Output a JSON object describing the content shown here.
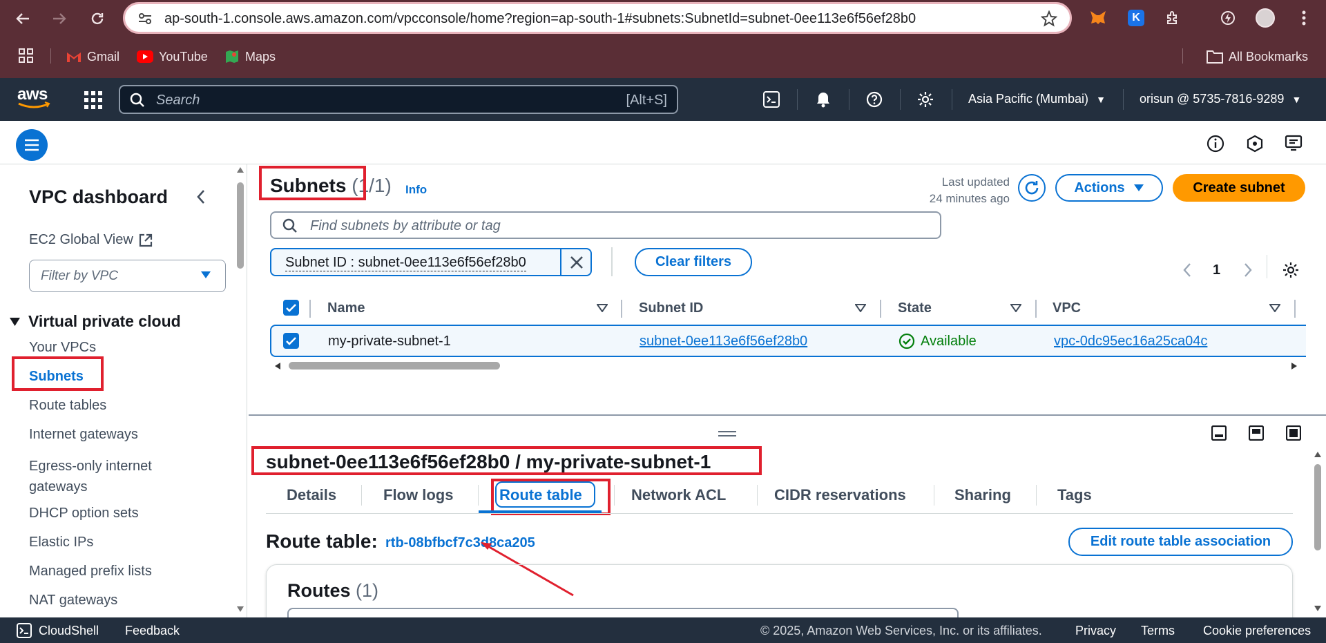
{
  "browser": {
    "url": "ap-south-1.console.aws.amazon.com/vpcconsole/home?region=ap-south-1#subnets:SubnetId=subnet-0ee113e6f56ef28b0",
    "bookmarks": [
      "Gmail",
      "YouTube",
      "Maps"
    ],
    "all_bookmarks": "All Bookmarks"
  },
  "aws_nav": {
    "logo": "aws",
    "search_placeholder": "Search",
    "search_shortcut": "[Alt+S]",
    "region": "Asia Pacific (Mumbai)",
    "account": "orisun @ 5735-7816-9289"
  },
  "sidebar": {
    "title": "VPC dashboard",
    "ec2_global_view": "EC2 Global View",
    "filter_placeholder": "Filter by VPC",
    "section": "Virtual private cloud",
    "items": [
      "Your VPCs",
      "Subnets",
      "Route tables",
      "Internet gateways",
      "Egress-only internet gateways",
      "DHCP option sets",
      "Elastic IPs",
      "Managed prefix lists",
      "NAT gateways"
    ]
  },
  "subnets": {
    "title": "Subnets",
    "count": "(1/1)",
    "info": "Info",
    "last_updated_label": "Last updated",
    "last_updated_value": "24 minutes ago",
    "actions": "Actions",
    "create": "Create subnet",
    "search_placeholder": "Find subnets by attribute or tag",
    "filter_chip": "Subnet ID : subnet-0ee113e6f56ef28b0",
    "clear_filters": "Clear filters",
    "page": "1",
    "columns": [
      "Name",
      "Subnet ID",
      "State",
      "VPC"
    ],
    "rows": [
      {
        "name": "my-private-subnet-1",
        "subnet_id": "subnet-0ee113e6f56ef28b0",
        "state": "Available",
        "vpc": "vpc-0dc95ec16a25ca04c"
      }
    ]
  },
  "detail": {
    "title": "subnet-0ee113e6f56ef28b0 / my-private-subnet-1",
    "tabs": [
      "Details",
      "Flow logs",
      "Route table",
      "Network ACL",
      "CIDR reservations",
      "Sharing",
      "Tags"
    ],
    "active_tab": "Route table",
    "route_table_label": "Route table:",
    "route_table_id": "rtb-08bfbcf7c3d8ca205",
    "edit_button": "Edit route table association",
    "routes_title": "Routes",
    "routes_count": "(1)"
  },
  "footer": {
    "cloudshell": "CloudShell",
    "feedback": "Feedback",
    "copyright": "© 2025, Amazon Web Services, Inc. or its affiliates.",
    "privacy": "Privacy",
    "terms": "Terms",
    "cookies": "Cookie preferences"
  },
  "colors": {
    "aws_nav": "#232f3e",
    "browser_chrome": "#5a2e36",
    "link": "#0972d3",
    "primary_button": "#ff9900",
    "highlight": "#e0202e",
    "success": "#037f0c"
  }
}
